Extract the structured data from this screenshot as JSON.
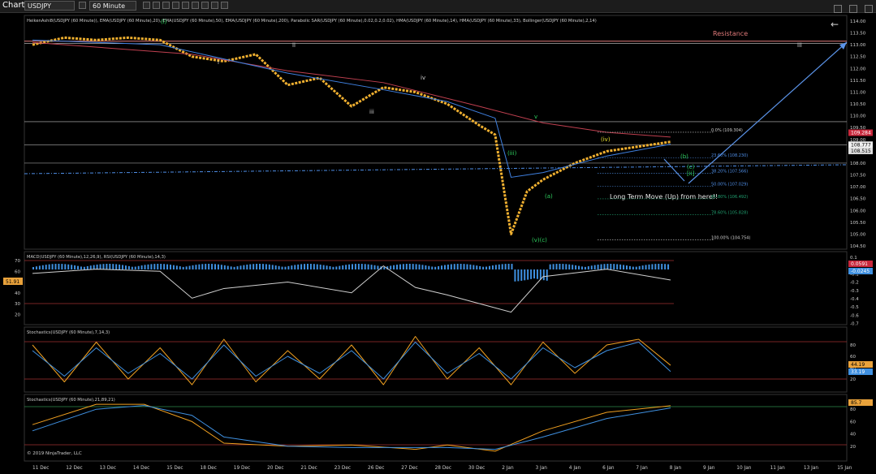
{
  "toolbar": {
    "title": "Chart",
    "instrument": "USDJPY",
    "timeframe": "60 Minute"
  },
  "panels": {
    "price_header": "HeikenAshi8(USDJPY (60 Minute)), EMA(USDJPY (60 Minute),20), EMA(USDJPY (60 Minute),50), EMA(USDJPY (60 Minute),200), Parabolic SAR(USDJPY (60 Minute),0.02,0.2,0.02), HMA(USDJPY (60 Minute),14), HMA(USDJPY (60 Minute),33), Bollinger(USDJPY (60 Minute),2,14)",
    "macd_header": "MACD(USDJPY (60 Minute),12,26,9), RSI(USDJPY (60 Minute),14,3)",
    "stoch1_header": "Stochastics(USDJPY (60 Minute),7,14,3)",
    "stoch2_header": "Stochastics(USDJPY (60 Minute),21,89,21)",
    "copyright": "© 2019 NinjaTrader, LLC"
  },
  "annotations": {
    "resistance": "Resistance",
    "long_term": "Long Term Move (Up) from here!!",
    "waves": [
      "(i)",
      "i",
      "ii",
      "iii",
      "iv",
      "v",
      "(iii)",
      "(iv)",
      "(v)",
      "(a)",
      "(b)",
      "(c)",
      "[ii]",
      "(v)(c)",
      "iii"
    ]
  },
  "fib_levels": [
    {
      "label": "0.0% (109.304)",
      "color": "#cfcfcf",
      "value": 109.304
    },
    {
      "label": "23.60% (108.230)",
      "color": "#4f8fe8",
      "value": 108.23
    },
    {
      "label": "38.20% (107.566)",
      "color": "#4f8fe8",
      "value": 107.566
    },
    {
      "label": "50.00% (107.029)",
      "color": "#4f8fe8",
      "value": 107.029
    },
    {
      "label": "61.80% (106.492)",
      "color": "#20a070",
      "value": 106.492
    },
    {
      "label": "78.60% (105.828)",
      "color": "#20a070",
      "value": 105.828
    },
    {
      "label": "100.00% (104.754)",
      "color": "#cfcfcf",
      "value": 104.754
    }
  ],
  "price_badges": [
    {
      "text": "109.284",
      "bg": "#c8283c",
      "fg": "#ffffff",
      "value": 109.284
    },
    {
      "text": "108.777",
      "bg": "#f0f0f0",
      "fg": "#000000",
      "value": 108.777
    },
    {
      "text": "108.515",
      "bg": "#e0e0e0",
      "fg": "#000000",
      "value": 108.515
    }
  ],
  "indicator_badges": {
    "rsi": "51.91",
    "macd1": "0.0591",
    "macd2": "-0.0245",
    "stoch_k": "44.19",
    "stoch_d": "33.19",
    "stoch2": "85.7"
  },
  "chart_data": [
    {
      "type": "line",
      "title": "USDJPY (60 Minute)",
      "x_ticks": [
        "11 Dec",
        "12 Dec",
        "13 Dec",
        "14 Dec",
        "15 Dec",
        "18 Dec",
        "19 Dec",
        "20 Dec",
        "21 Dec",
        "23 Dec",
        "26 Dec",
        "27 Dec",
        "28 Dec",
        "30 Dec",
        "2 Jan",
        "3 Jan",
        "4 Jan",
        "6 Jan",
        "7 Jan",
        "8 Jan",
        "9 Jan",
        "10 Jan",
        "11 Jan",
        "13 Jan",
        "15 Jan"
      ],
      "y_ticks": [
        "114.00",
        "113.50",
        "113.00",
        "112.50",
        "112.00",
        "111.50",
        "111.00",
        "110.50",
        "110.00",
        "109.50",
        "109.00",
        "108.50",
        "108.00",
        "107.50",
        "107.00",
        "106.50",
        "106.00",
        "105.50",
        "105.00",
        "104.50"
      ],
      "ylim": [
        104.2,
        114.2
      ],
      "horizontal_levels": [
        113.15,
        113.05,
        109.75,
        108.77,
        108.0
      ],
      "series": [
        {
          "color": "#f0b030",
          "x": [
            0,
            1,
            2,
            3,
            4,
            5,
            6,
            7,
            8,
            9,
            10,
            11,
            12,
            13,
            14,
            14.5,
            15,
            15.5,
            16,
            17,
            18,
            19,
            20
          ],
          "values": [
            113.0,
            113.3,
            113.2,
            113.3,
            113.2,
            112.5,
            112.3,
            112.6,
            111.3,
            111.6,
            110.4,
            111.2,
            111.0,
            110.5,
            109.6,
            109.2,
            105.0,
            106.8,
            107.3,
            108.0,
            108.5,
            108.7,
            108.9
          ]
        },
        {
          "color": "#c04050",
          "x": [
            0,
            5,
            8,
            11,
            14,
            16,
            18,
            20
          ],
          "values": [
            113.1,
            112.6,
            111.9,
            111.4,
            110.4,
            109.7,
            109.3,
            109.1
          ]
        },
        {
          "color": "#3f80e0",
          "x": [
            0,
            4,
            8,
            11,
            13,
            14.5,
            15,
            16,
            18,
            20
          ],
          "values": [
            113.2,
            113.0,
            111.8,
            111.1,
            110.6,
            109.9,
            107.4,
            107.6,
            108.3,
            108.8
          ]
        }
      ]
    },
    {
      "type": "line",
      "title": "MACD / RSI",
      "y_ticks_left": [
        "70",
        "60",
        "50",
        "40",
        "30",
        "20"
      ],
      "y_ticks_right": [
        "0.1",
        "0",
        "-0.1",
        "-0.2",
        "-0.3",
        "-0.4",
        "-0.5",
        "-0.6",
        "-0.7"
      ],
      "horizontal_levels": [
        70,
        30
      ],
      "series": [
        {
          "name": "RSI",
          "color": "#cfcfcf",
          "x": [
            0,
            2,
            4,
            5,
            6,
            8,
            10,
            11,
            12,
            13,
            14,
            15,
            16,
            18,
            20
          ],
          "values": [
            58,
            62,
            60,
            35,
            44,
            50,
            40,
            65,
            45,
            38,
            30,
            22,
            55,
            62,
            51.91
          ]
        }
      ]
    },
    {
      "type": "line",
      "title": "Stochastics (7,14,3)",
      "y_ticks": [
        "80",
        "60",
        "40",
        "20"
      ],
      "horizontal_levels": [
        80,
        20
      ],
      "series": [
        {
          "color": "#f0a020",
          "x": [
            0,
            1,
            2,
            3,
            4,
            5,
            6,
            7,
            8,
            9,
            10,
            11,
            12,
            13,
            14,
            15,
            16,
            17,
            18,
            19,
            20
          ],
          "values": [
            80,
            15,
            85,
            20,
            75,
            10,
            90,
            15,
            70,
            20,
            80,
            10,
            95,
            20,
            75,
            10,
            85,
            30,
            80,
            90,
            44.19
          ]
        },
        {
          "color": "#3f90e0",
          "x": [
            0,
            1,
            2,
            3,
            4,
            5,
            6,
            7,
            8,
            9,
            10,
            11,
            12,
            13,
            14,
            15,
            16,
            17,
            18,
            19,
            20
          ],
          "values": [
            70,
            25,
            75,
            30,
            65,
            20,
            80,
            25,
            60,
            30,
            70,
            20,
            85,
            30,
            65,
            20,
            75,
            40,
            70,
            85,
            33.19
          ]
        }
      ]
    },
    {
      "type": "line",
      "title": "Stochastics (21,89,21)",
      "y_ticks": [
        "80",
        "60",
        "40",
        "20"
      ],
      "horizontal_levels": [
        80,
        20
      ],
      "series": [
        {
          "color": "#f0a020",
          "x": [
            0,
            2,
            3.5,
            5,
            6,
            8,
            10,
            12,
            13,
            14.5,
            16,
            18,
            20
          ],
          "values": [
            55,
            88,
            88,
            60,
            25,
            20,
            22,
            15,
            22,
            12,
            45,
            75,
            85.7
          ]
        },
        {
          "color": "#3f90e0",
          "x": [
            0,
            2,
            3.5,
            5,
            6,
            8,
            10,
            12,
            13,
            14.5,
            16,
            18,
            20
          ],
          "values": [
            45,
            80,
            86,
            70,
            35,
            20,
            18,
            18,
            18,
            15,
            35,
            65,
            82
          ]
        }
      ]
    }
  ]
}
